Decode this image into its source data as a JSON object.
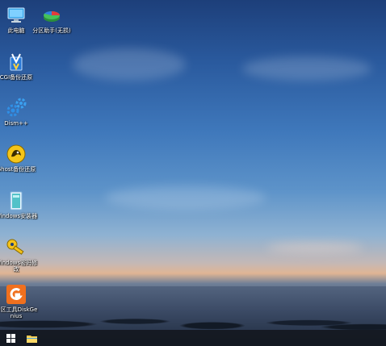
{
  "desktop": {
    "icons": [
      {
        "label": "此电脑",
        "icon": "computer-icon"
      },
      {
        "label": "分区助手(无损)",
        "icon": "partition-assistant-icon"
      },
      {
        "label": "CGI备份还原",
        "icon": "cgi-backup-icon"
      },
      {
        "label": "Dism++",
        "icon": "gears-icon"
      },
      {
        "label": "Ghost备份还原",
        "icon": "ghost-icon"
      },
      {
        "label": "Windows安装器",
        "icon": "windows-installer-icon"
      },
      {
        "label": "Windows密码修改",
        "icon": "key-icon"
      },
      {
        "label": "分区工具DiskGenius",
        "icon": "diskgenius-icon"
      }
    ]
  },
  "taskbar": {
    "buttons": [
      {
        "name": "start",
        "icon": "windows-logo-icon"
      },
      {
        "name": "file-explorer",
        "icon": "folder-icon"
      }
    ]
  },
  "colors": {
    "taskbar": "#141820",
    "accent": "#1e90ff"
  }
}
